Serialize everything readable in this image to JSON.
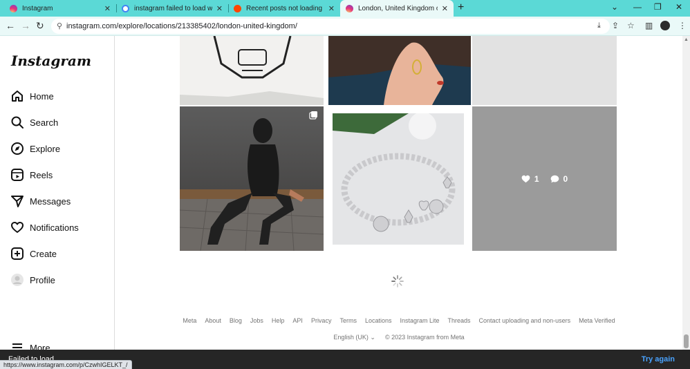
{
  "browser": {
    "tabs": [
      {
        "title": "Instagram",
        "favicon": "instagram-icon"
      },
      {
        "title": "instagram failed to load when b",
        "favicon": "google-icon"
      },
      {
        "title": "Recent posts not loading for Lo",
        "favicon": "reddit-icon"
      },
      {
        "title": "London, United Kingdom on Ins",
        "favicon": "instagram-icon",
        "active": true
      }
    ],
    "url": "instagram.com/explore/locations/213385402/london-united-kingdom/",
    "accent_color": "#5bd9d6"
  },
  "sidebar": {
    "logo": "Instagram",
    "items": [
      {
        "label": "Home",
        "icon": "home-icon"
      },
      {
        "label": "Search",
        "icon": "search-icon"
      },
      {
        "label": "Explore",
        "icon": "compass-icon"
      },
      {
        "label": "Reels",
        "icon": "reels-icon"
      },
      {
        "label": "Messages",
        "icon": "messenger-icon"
      },
      {
        "label": "Notifications",
        "icon": "heart-icon"
      },
      {
        "label": "Create",
        "icon": "plus-square-icon"
      },
      {
        "label": "Profile",
        "icon": "profile-avatar"
      },
      {
        "label": "More",
        "icon": "menu-icon"
      }
    ]
  },
  "grid": {
    "hover_post": {
      "likes": "1",
      "comments": "0"
    }
  },
  "footer": {
    "links": [
      "Meta",
      "About",
      "Blog",
      "Jobs",
      "Help",
      "API",
      "Privacy",
      "Terms",
      "Locations",
      "Instagram Lite",
      "Threads",
      "Contact uploading and non-users",
      "Meta Verified"
    ],
    "language": "English (UK)",
    "copyright": "© 2023 Instagram from Meta"
  },
  "error_bar": {
    "message": "Failed to load",
    "retry_label": "Try again"
  },
  "status_url": "https://www.instagram.com/p/CzwhIGELKT_/"
}
